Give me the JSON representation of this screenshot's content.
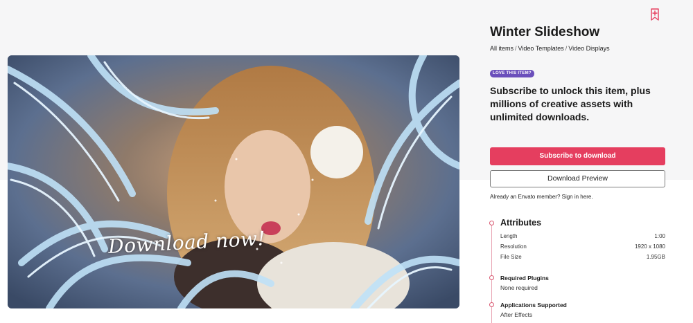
{
  "item": {
    "title": "Winter Slideshow",
    "breadcrumb": [
      "All items",
      "Video Templates",
      "Video Displays"
    ],
    "preview_watermark": "Download now!"
  },
  "promo": {
    "badge": "LOVE THIS ITEM?",
    "text": "Subscribe to unlock this item, plus millions of creative assets with unlimited downloads.",
    "subscribe_label": "Subscribe to download",
    "preview_label": "Download Preview",
    "signin_text": "Already an Envato member? Sign in here."
  },
  "attributes": {
    "heading": "Attributes",
    "rows": [
      {
        "label": "Length",
        "value": "1:00"
      },
      {
        "label": "Resolution",
        "value": "1920 x 1080"
      },
      {
        "label": "File Size",
        "value": "1.95GB"
      }
    ],
    "required_plugins": {
      "heading": "Required Plugins",
      "value": "None required"
    },
    "applications": {
      "heading": "Applications Supported",
      "value": "After Effects"
    }
  },
  "colors": {
    "accent": "#e53e5f",
    "badge": "#6b4fbb"
  },
  "icons": {
    "bookmark": "bookmark-add-icon"
  }
}
